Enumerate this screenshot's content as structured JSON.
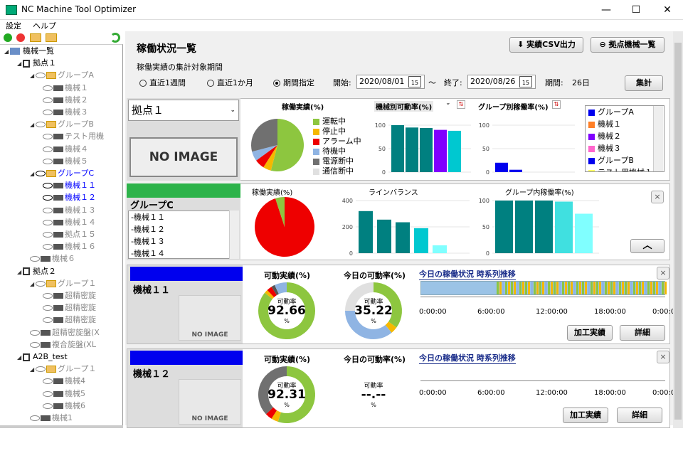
{
  "window": {
    "title": "NC Machine Tool Optimizer",
    "minimize": "—",
    "maximize": "☐",
    "close": "✕"
  },
  "menu": {
    "settings": "設定",
    "help": "ヘルプ"
  },
  "tree": [
    {
      "label": "機械一覧",
      "level": 0,
      "kind": "root"
    },
    {
      "label": "拠点１",
      "level": 1,
      "kind": "site"
    },
    {
      "label": "グループA",
      "level": 2,
      "kind": "group",
      "state": "gray"
    },
    {
      "label": "機械１",
      "level": 3,
      "kind": "machine",
      "state": "gray"
    },
    {
      "label": "機械２",
      "level": 3,
      "kind": "machine",
      "state": "gray"
    },
    {
      "label": "機械３",
      "level": 3,
      "kind": "machine",
      "state": "gray"
    },
    {
      "label": "グループB",
      "level": 2,
      "kind": "group",
      "state": "gray"
    },
    {
      "label": "テスト用機",
      "level": 3,
      "kind": "machine",
      "state": "gray"
    },
    {
      "label": "機械４",
      "level": 3,
      "kind": "machine",
      "state": "gray"
    },
    {
      "label": "機械５",
      "level": 3,
      "kind": "machine",
      "state": "gray"
    },
    {
      "label": "グループC",
      "level": 2,
      "kind": "group",
      "state": "blue"
    },
    {
      "label": "機械１１",
      "level": 3,
      "kind": "machine",
      "state": "blue"
    },
    {
      "label": "機械１２",
      "level": 3,
      "kind": "machine",
      "state": "blue"
    },
    {
      "label": "機械１３",
      "level": 3,
      "kind": "machine",
      "state": "gray"
    },
    {
      "label": "機械１４",
      "level": 3,
      "kind": "machine",
      "state": "gray"
    },
    {
      "label": "拠点１５",
      "level": 3,
      "kind": "machine",
      "state": "gray"
    },
    {
      "label": "機械１６",
      "level": 3,
      "kind": "machine",
      "state": "gray"
    },
    {
      "label": "機械６",
      "level": 2,
      "kind": "machine",
      "state": "gray"
    },
    {
      "label": "拠点２",
      "level": 1,
      "kind": "site"
    },
    {
      "label": "グループ１",
      "level": 2,
      "kind": "group",
      "state": "gray"
    },
    {
      "label": "超精密旋",
      "level": 3,
      "kind": "machine",
      "state": "gray"
    },
    {
      "label": "超精密旋",
      "level": 3,
      "kind": "machine",
      "state": "gray"
    },
    {
      "label": "超精密旋",
      "level": 3,
      "kind": "machine",
      "state": "gray"
    },
    {
      "label": "超精密旋盤(X",
      "level": 2,
      "kind": "machine",
      "state": "gray"
    },
    {
      "label": "複合旋盤(XL",
      "level": 2,
      "kind": "machine",
      "state": "gray"
    },
    {
      "label": "A2B_test",
      "level": 1,
      "kind": "site"
    },
    {
      "label": "グループ１",
      "level": 2,
      "kind": "group",
      "state": "gray"
    },
    {
      "label": "機械4",
      "level": 3,
      "kind": "machine",
      "state": "gray"
    },
    {
      "label": "機械5",
      "level": 3,
      "kind": "machine",
      "state": "gray"
    },
    {
      "label": "機械6",
      "level": 3,
      "kind": "machine",
      "state": "gray"
    },
    {
      "label": "機械1",
      "level": 2,
      "kind": "machine",
      "state": "gray"
    }
  ],
  "header": {
    "title": "稼働状況一覧",
    "csv_button": "実績CSV出力",
    "site_list_button": "拠点機械一覧",
    "period_label": "稼働実績の集計対象期間"
  },
  "period": {
    "opt_week": "直近1週間",
    "opt_month": "直近1か月",
    "opt_custom": "期間指定",
    "start_label": "開始:",
    "start": "2020/08/01",
    "tilde": "〜",
    "end_label": "終了:",
    "end": "2020/08/26",
    "days_label": "期間:",
    "days": "26日",
    "aggregate": "集計",
    "calendar": "15"
  },
  "site": {
    "selected": "拠点１",
    "noimage": "NO IMAGE"
  },
  "site_pie": {
    "title": "稼働実績(%)",
    "legend": [
      {
        "label": "運転中",
        "color": "#8dc63f"
      },
      {
        "label": "停止中",
        "color": "#f5b800"
      },
      {
        "label": "アラーム中",
        "color": "#ee0000"
      },
      {
        "label": "待機中",
        "color": "#8fb4e3"
      },
      {
        "label": "電源断中",
        "color": "#707070"
      },
      {
        "label": "通信断中",
        "color": "#e0e0e0"
      }
    ],
    "values": [
      54,
      5,
      6,
      6,
      29,
      0
    ]
  },
  "machine_bar": {
    "title": "機械別可動率(%)",
    "ticks": [
      "100",
      "50",
      "0"
    ],
    "values": [
      100,
      95,
      94,
      90,
      88
    ],
    "colors": [
      "#008080",
      "#008080",
      "#008080",
      "#8000ff",
      "#00c8d0"
    ]
  },
  "group_bar": {
    "title": "グループ別稼働率(%)",
    "ticks": [
      "100",
      "50",
      "0"
    ],
    "values": [
      20,
      5
    ],
    "colors": [
      "#0000ee",
      "#0000ee"
    ]
  },
  "site_legend": [
    {
      "label": "グループA",
      "color": "#0000ee"
    },
    {
      "label": "機械１",
      "color": "#ff7f27"
    },
    {
      "label": "機械２",
      "color": "#8000ff"
    },
    {
      "label": "機械３",
      "color": "#ff66cc"
    },
    {
      "label": "グループB",
      "color": "#0000ee"
    },
    {
      "label": "テスト用機械１",
      "color": "#ffff66"
    }
  ],
  "group": {
    "name": "グループC",
    "members": [
      "-機械１１",
      "-機械１２",
      "-機械１３",
      "-機械１４"
    ],
    "pie_title": "稼働実績(%)",
    "pie_values": [
      95,
      5
    ],
    "pie_colors": [
      "#ee0000",
      "#8dc63f"
    ],
    "line_title": "ラインバランス",
    "line_ticks": [
      "400",
      "200",
      "0"
    ],
    "line_values": [
      320,
      255,
      235,
      190,
      60
    ],
    "line_colors": [
      "#008080",
      "#008080",
      "#008080",
      "#00c8d0",
      "#80ffff"
    ],
    "rate_title": "グループ内稼働率(%)",
    "rate_ticks": [
      "100",
      "50",
      "0"
    ],
    "rate_values": [
      100,
      100,
      100,
      98,
      75
    ],
    "rate_colors": [
      "#008080",
      "#008080",
      "#008080",
      "#40e0e0",
      "#80ffff"
    ],
    "collapse": "︿",
    "close": "×"
  },
  "machines": [
    {
      "name": "機械１１",
      "noimage": "NO IMAGE",
      "actual_title": "可動実績(%)",
      "rate_label": "可動率",
      "rate": "92.66",
      "unit": "%",
      "today_title": "今日の可動率(%)",
      "today_label": "可動率",
      "today": "35.22",
      "today_unit": "%",
      "timeline_title": "今日の稼働状況 時系列推移",
      "times": [
        "0:00:00",
        "6:00:00",
        "12:00:00",
        "18:00:00",
        "0:00:00"
      ],
      "btn_results": "加工実績",
      "btn_detail": "詳細",
      "close": "×"
    },
    {
      "name": "機械１２",
      "noimage": "NO IMAGE",
      "actual_title": "可動実績(%)",
      "rate_label": "可動率",
      "rate": "92.31",
      "unit": "%",
      "today_title": "今日の可動率(%)",
      "today_label": "可動率",
      "today": "--.--",
      "today_unit": "%",
      "timeline_title": "今日の稼働状況 時系列推移",
      "times": [
        "0:00:00",
        "6:00:00",
        "12:00:00",
        "18:00:00",
        "0:00:00"
      ],
      "btn_results": "加工実績",
      "btn_detail": "詳細",
      "close": "×"
    }
  ]
}
